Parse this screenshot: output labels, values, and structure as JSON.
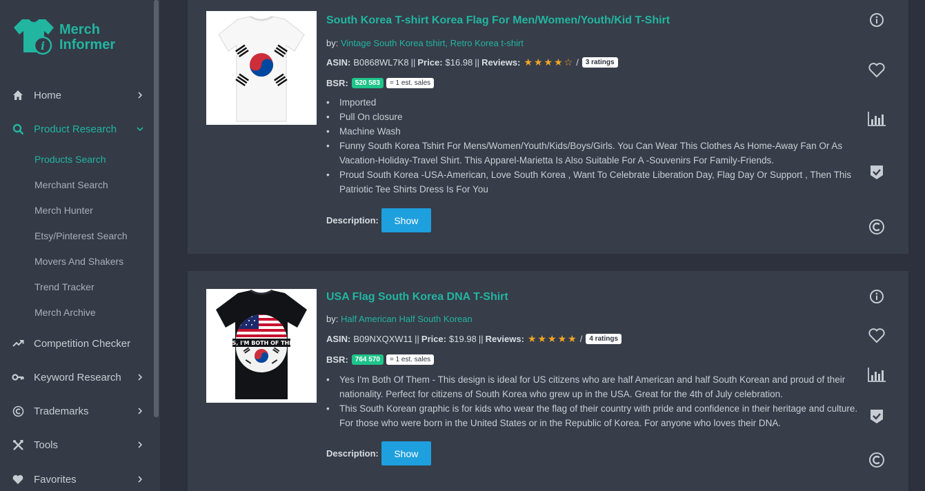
{
  "brand": {
    "name_line1": "Merch",
    "name_line2": "Informer",
    "color": "#22b5a0"
  },
  "sidebar": {
    "items": [
      {
        "label": "Home",
        "icon": "home-icon",
        "chevron": "chevron-right"
      },
      {
        "label": "Product Research",
        "icon": "search-icon",
        "chevron": "chevron-down",
        "active": true
      },
      {
        "label": "Competition Checker",
        "icon": "trend-icon"
      },
      {
        "label": "Keyword Research",
        "icon": "key-icon",
        "chevron": "chevron-right"
      },
      {
        "label": "Trademarks",
        "icon": "copyright-icon",
        "chevron": "chevron-right"
      },
      {
        "label": "Tools",
        "icon": "tools-icon",
        "chevron": "chevron-right"
      },
      {
        "label": "Favorites",
        "icon": "heart-icon",
        "chevron": "chevron-right"
      }
    ],
    "subitems": [
      {
        "label": "Products Search",
        "active": true
      },
      {
        "label": "Merchant Search"
      },
      {
        "label": "Merch Hunter"
      },
      {
        "label": "Etsy/Pinterest Search"
      },
      {
        "label": "Movers And Shakers"
      },
      {
        "label": "Trend Tracker"
      },
      {
        "label": "Merch Archive"
      }
    ]
  },
  "products": [
    {
      "title": "South Korea T-shirt Korea Flag For Men/Women/Youth/Kid T-Shirt",
      "by_label": "by:",
      "brand": "Vintage South Korea tshirt, Retro Korea t-shirt",
      "asin_label": "ASIN:",
      "asin": "B0868WL7K8",
      "price_label": "Price:",
      "price": "$16.98",
      "reviews_label": "Reviews:",
      "stars": "★★★★☆",
      "rating": 4,
      "ratings_text": "3 ratings",
      "bsr_label": "BSR:",
      "bsr": "520 583",
      "sales": "= 1 est. sales",
      "bullets": [
        "Imported",
        "Pull On closure",
        "Machine Wash",
        "Funny South Korea Tshirt For Mens/Women/Youth/Kids/Boys/Girls. You Can Wear This Clothes As Home-Away Fan Or As Vacation-Holiday-Travel Shirt. This Apparel-Marietta Is Also Suitable For A -Souvenirs For Family-Friends.",
        "Proud South Korea -USA-American, Love South Korea , Want To Celebrate Liberation Day, Flag Day Or Support , Then This Patriotic Tee Shirts Dress Is For You"
      ],
      "description_label": "Description:",
      "show_label": "Show"
    },
    {
      "title": "USA Flag South Korea DNA T-Shirt",
      "by_label": "by:",
      "brand": "Half American Half South Korean",
      "asin_label": "ASIN:",
      "asin": "B09NXQXW11",
      "price_label": "Price:",
      "price": "$19.98",
      "reviews_label": "Reviews:",
      "stars": "★★★★★",
      "rating": 5,
      "ratings_text": "4 ratings",
      "bsr_label": "BSR:",
      "bsr": "764 570",
      "sales": "= 1 est. sales",
      "shirt_text": "YES, I'M BOTH OF THEM",
      "bullets": [
        "Yes I'm Both Of Them - This design is ideal for US citizens who are half American and half South Korean and proud of their nationality. Perfect for citizens of South Korea who grew up in the USA. Great for the 4th of July celebration.",
        "This South Korean graphic is for kids who wear the flag of their country with pride and confidence in their heritage and culture. For those who were born in the United States or in the Republic of Korea. For anyone who loves their DNA."
      ],
      "description_label": "Description:",
      "show_label": "Show"
    }
  ],
  "colors": {
    "accent": "#22b5a0",
    "button": "#1e9fde",
    "star": "#f5a623",
    "bsr": "#1ec48a"
  }
}
